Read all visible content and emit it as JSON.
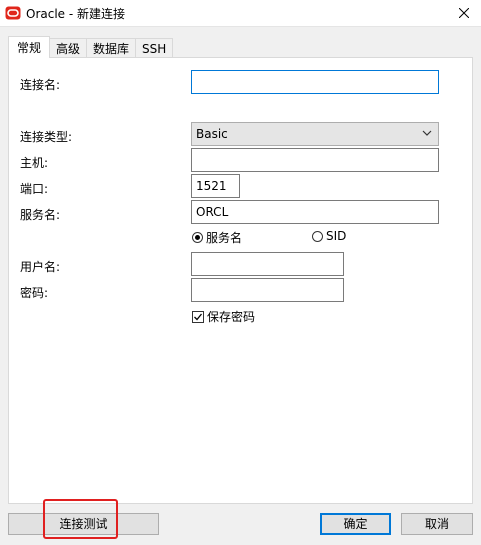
{
  "window": {
    "title": "Oracle - 新建连接",
    "brand_color": "#e0261b",
    "close_icon": "close-icon"
  },
  "tabs": [
    {
      "label": "常规",
      "active": true
    },
    {
      "label": "高级",
      "active": false
    },
    {
      "label": "数据库",
      "active": false
    },
    {
      "label": "SSH",
      "active": false
    }
  ],
  "form": {
    "connection_name_label": "连接名:",
    "connection_name_value": "",
    "connection_type_label": "连接类型:",
    "connection_type_value": "Basic",
    "host_label": "主机:",
    "host_value": "",
    "port_label": "端口:",
    "port_value": "1521",
    "service_name_label": "服务名:",
    "service_name_value": "ORCL",
    "radio_service_name": "服务名",
    "radio_sid": "SID",
    "username_label": "用户名:",
    "username_value": "",
    "password_label": "密码:",
    "password_value": "",
    "save_password_label": "保存密码",
    "save_password_checked": true
  },
  "buttons": {
    "test_connection": "连接测试",
    "ok": "确定",
    "cancel": "取消"
  },
  "accent_color": "#0078d7",
  "highlight_color": "#e02020"
}
